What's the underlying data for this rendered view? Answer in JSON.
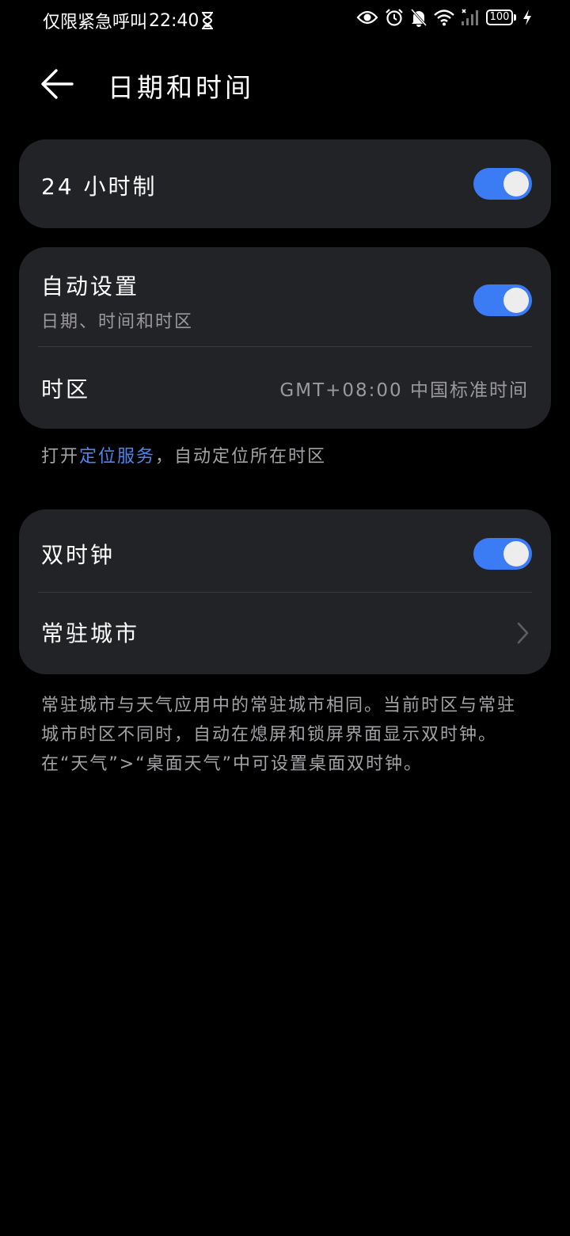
{
  "status_bar": {
    "left_text": "仅限紧急呼叫",
    "time": "22:40",
    "battery": "100"
  },
  "header": {
    "title": "日期和时间"
  },
  "settings": {
    "hour24": {
      "label": "24 小时制",
      "enabled": true
    },
    "auto_set": {
      "label": "自动设置",
      "sublabel": "日期、时间和时区",
      "enabled": true
    },
    "timezone": {
      "label": "时区",
      "value": "GMT+08:00 中国标准时间"
    },
    "location_note": {
      "prefix": "打开",
      "link": "定位服务",
      "suffix": "，自动定位所在时区"
    },
    "dual_clock": {
      "label": "双时钟",
      "enabled": true
    },
    "home_city": {
      "label": "常驻城市"
    },
    "dual_clock_note": "常驻城市与天气应用中的常驻城市相同。当前时区与常驻城市时区不同时，自动在熄屏和锁屏界面显示双时钟。在“天气”>“桌面天气”中可设置桌面双时钟。"
  },
  "colors": {
    "accent": "#3b7cf4",
    "link": "#4d86f0",
    "card_bg": "#222326",
    "page_bg": "#000000"
  },
  "icons": {
    "status": [
      "hourglass-icon",
      "eye-icon",
      "alarm-icon",
      "bell-off-icon",
      "wifi-icon",
      "signal-icon",
      "battery-icon",
      "charging-icon"
    ],
    "back": "arrow-left-icon",
    "row_arrow": "chevron-right-icon"
  }
}
